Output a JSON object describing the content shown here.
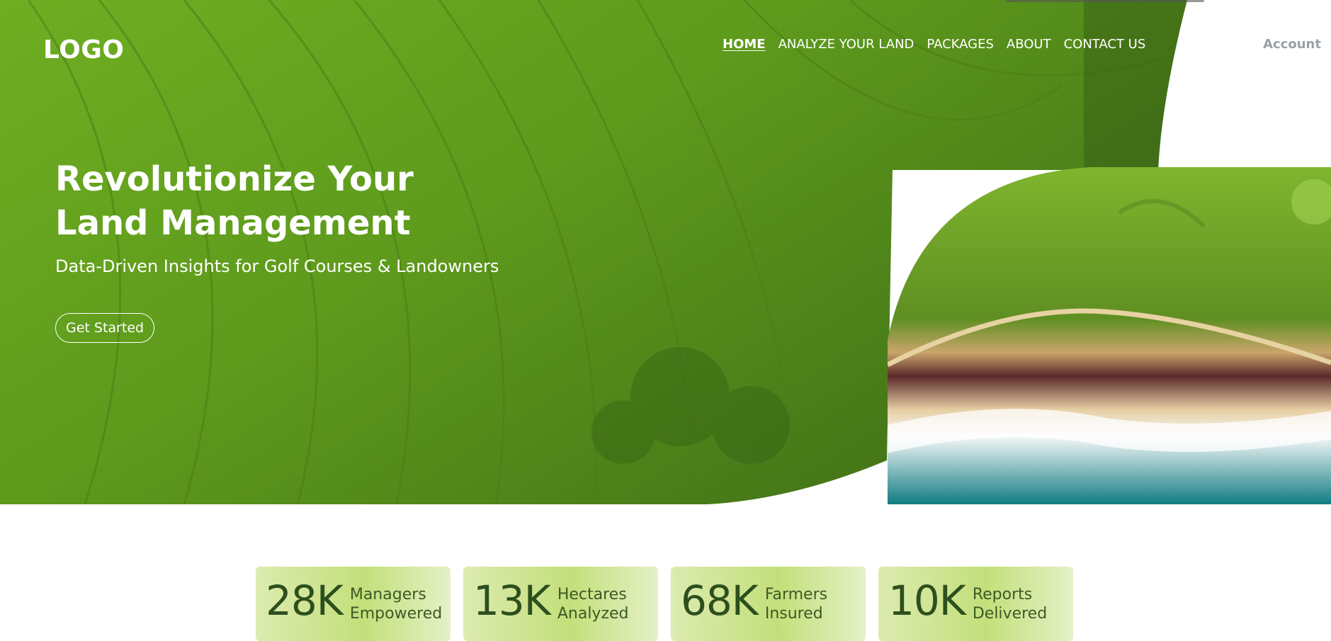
{
  "header": {
    "logo": "LOGO",
    "nav": [
      {
        "label": "HOME",
        "active": true
      },
      {
        "label": "ANALYZE YOUR LAND"
      },
      {
        "label": "PACKAGES"
      },
      {
        "label": "ABOUT"
      },
      {
        "label": "CONTACT US"
      }
    ],
    "account": "Account"
  },
  "hero": {
    "title_line1": "Revolutionize Your",
    "title_line2": "Land Management",
    "subtitle": "Data-Driven Insights for Golf Courses & Landowners",
    "cta": "Get Started"
  },
  "stats": [
    {
      "value": "28K",
      "label_line1": "Managers",
      "label_line2": "Empowered"
    },
    {
      "value": "13K",
      "label_line1": "Hectares",
      "label_line2": "Analyzed"
    },
    {
      "value": "68K",
      "label_line1": "Farmers",
      "label_line2": "Insured"
    },
    {
      "value": "10K",
      "label_line1": "Reports",
      "label_line2": "Delivered"
    }
  ],
  "colors": {
    "hero_green": "#5a9a1c",
    "stat_text": "#2d4f1e",
    "account_text": "#9aa0a6"
  }
}
